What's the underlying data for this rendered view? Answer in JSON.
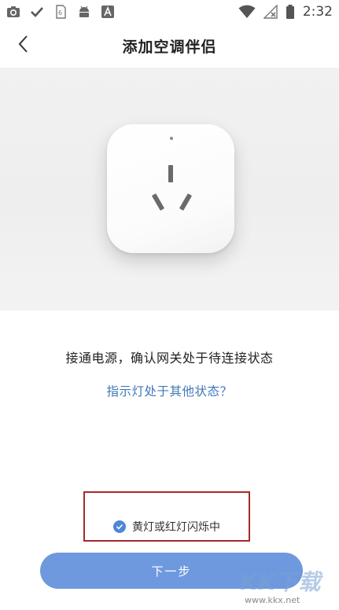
{
  "status_bar": {
    "time": "2:32",
    "left_icons": [
      "camera-icon",
      "check-icon",
      "sim-icon",
      "android-icon",
      "font-icon"
    ],
    "right_icons": [
      "wifi-icon",
      "no-signal-icon",
      "battery-icon"
    ]
  },
  "header": {
    "title": "添加空调伴侣",
    "back_icon": "chevron-left-icon"
  },
  "content": {
    "instruction": "接通电源，确认网关处于待连接状态",
    "other_status_link": "指示灯处于其他状态？",
    "confirm_label": "黄灯或红灯闪烁中",
    "confirm_checked": true
  },
  "footer": {
    "next_label": "下一步"
  },
  "watermark": {
    "logo": "KK下载",
    "url": "www.kkx.net"
  },
  "colors": {
    "accent": "#6f99de",
    "link": "#3e78b8",
    "check": "#4f86d8",
    "highlight_border": "#a42a2a"
  }
}
